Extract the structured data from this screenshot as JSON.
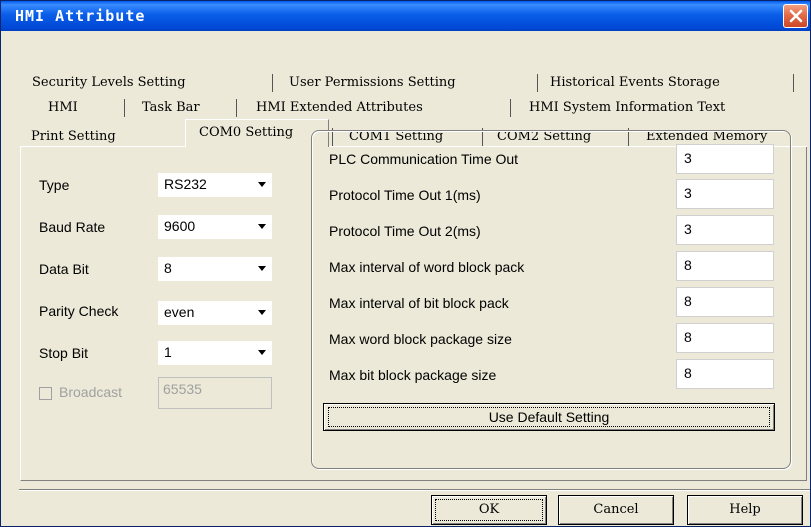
{
  "window": {
    "title": "HMI Attribute",
    "close_icon": "close-icon"
  },
  "tabs": {
    "row1": [
      "Security Levels Setting",
      "User Permissions Setting",
      "Historical Events Storage"
    ],
    "row2": [
      "HMI",
      "Task Bar",
      "HMI Extended Attributes",
      "HMI System Information Text"
    ],
    "row3": [
      "Print Setting",
      "COM0 Setting",
      "COM1 Setting",
      "COM2 Setting",
      "Extended Memory"
    ],
    "active": "COM0 Setting"
  },
  "com": {
    "type": {
      "label": "Type",
      "value": "RS232"
    },
    "baud_rate": {
      "label": "Baud Rate",
      "value": "9600"
    },
    "data_bit": {
      "label": "Data Bit",
      "value": "8"
    },
    "parity_check": {
      "label": "Parity Check",
      "value": "even"
    },
    "stop_bit": {
      "label": "Stop Bit",
      "value": "1"
    },
    "broadcast": {
      "label": "Broadcast",
      "value": "65535",
      "checked": false,
      "enabled": false
    }
  },
  "timeouts": [
    {
      "label": "PLC Communication Time Out",
      "value": "3"
    },
    {
      "label": "Protocol Time Out 1(ms)",
      "value": "3"
    },
    {
      "label": "Protocol Time Out 2(ms)",
      "value": "3"
    },
    {
      "label": "Max interval of word block pack",
      "value": "8"
    },
    {
      "label": "Max interval of bit block pack",
      "value": "8"
    },
    {
      "label": "Max word block package size",
      "value": "8"
    },
    {
      "label": "Max bit block package size",
      "value": "8"
    }
  ],
  "default_button": "Use Default Setting",
  "buttons": {
    "ok": "OK",
    "cancel": "Cancel",
    "help": "Help"
  },
  "colors": {
    "titlebar": "#0054e3",
    "close": "#e26c4a",
    "dialog": "#ece9d8"
  }
}
